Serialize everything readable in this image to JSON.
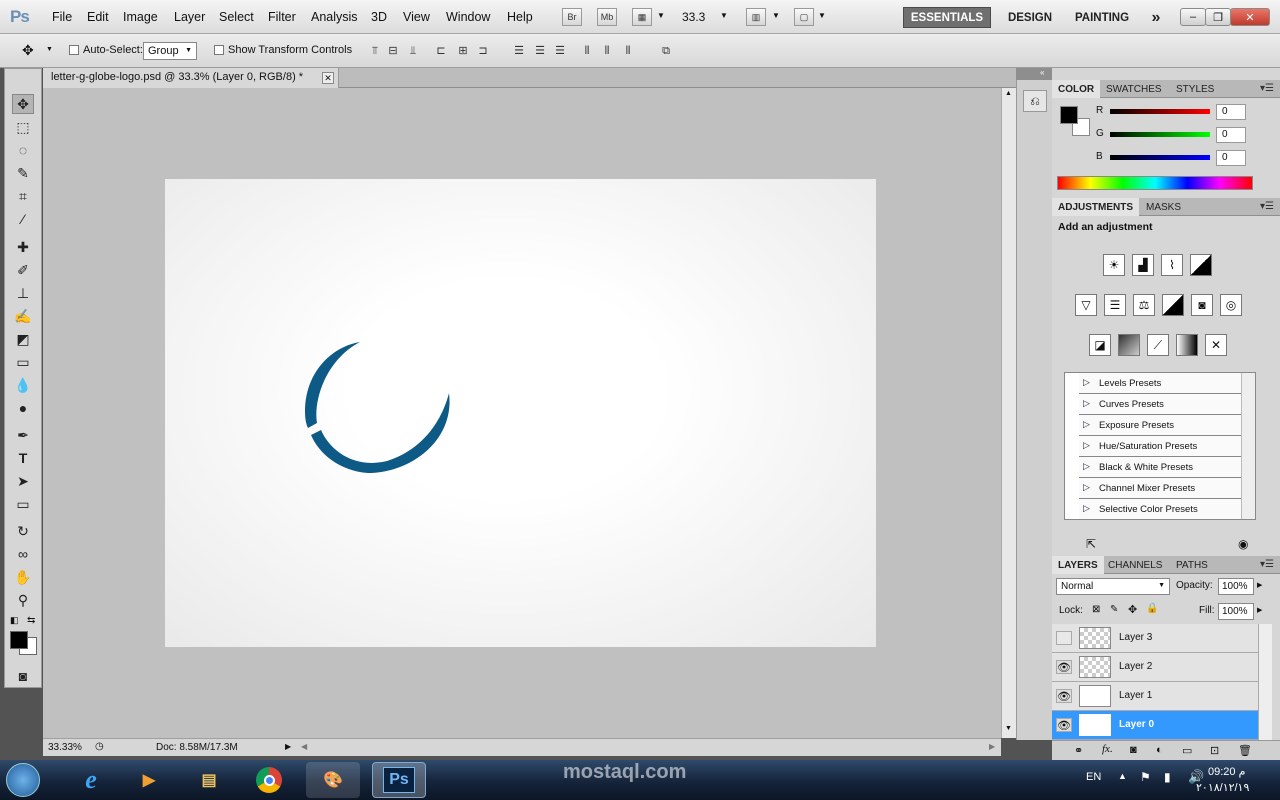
{
  "app": {
    "logo": "Ps"
  },
  "menu": [
    "File",
    "Edit",
    "Image",
    "Layer",
    "Select",
    "Filter",
    "Analysis",
    "3D",
    "View",
    "Window",
    "Help"
  ],
  "app_bar": {
    "br": "Br",
    "mb": "Mb",
    "zoom": "33.3"
  },
  "workspaces": {
    "essentials": "ESSENTIALS",
    "design": "DESIGN",
    "painting": "PAINTING",
    "more": "»"
  },
  "options": {
    "auto_select_label": "Auto-Select:",
    "auto_select_value": "Group",
    "transform_label": "Show Transform Controls"
  },
  "document": {
    "tab_title": "letter-g-globe-logo.psd @ 33.3% (Layer 0, RGB/8) *",
    "shape_color": "#0e5a86"
  },
  "status": {
    "zoom": "33.33%",
    "doc": "Doc: 8.58M/17.3M"
  },
  "color_panel": {
    "tabs": [
      "COLOR",
      "SWATCHES",
      "STYLES"
    ],
    "channels": [
      {
        "label": "R",
        "value": "0"
      },
      {
        "label": "G",
        "value": "0"
      },
      {
        "label": "B",
        "value": "0"
      }
    ]
  },
  "adjustments_panel": {
    "tabs": [
      "ADJUSTMENTS",
      "MASKS"
    ],
    "heading": "Add an adjustment",
    "presets": [
      "Levels Presets",
      "Curves Presets",
      "Exposure Presets",
      "Hue/Saturation Presets",
      "Black & White Presets",
      "Channel Mixer Presets",
      "Selective Color Presets"
    ]
  },
  "layers_panel": {
    "tabs": [
      "LAYERS",
      "CHANNELS",
      "PATHS"
    ],
    "blend_mode": "Normal",
    "opacity_label": "Opacity:",
    "opacity": "100%",
    "lock_label": "Lock:",
    "fill_label": "Fill:",
    "fill": "100%",
    "layers": [
      {
        "name": "Layer 3",
        "visible": false,
        "selected": false
      },
      {
        "name": "Layer 2",
        "visible": true,
        "selected": false
      },
      {
        "name": "Layer 1",
        "visible": true,
        "selected": false
      },
      {
        "name": "Layer 0",
        "visible": true,
        "selected": true
      }
    ],
    "footer_fx": "fx."
  },
  "taskbar": {
    "lang": "EN",
    "time": "09:20 م",
    "date": "٢٠١٨/١٢/١٩",
    "watermark": "mostaql.com"
  }
}
